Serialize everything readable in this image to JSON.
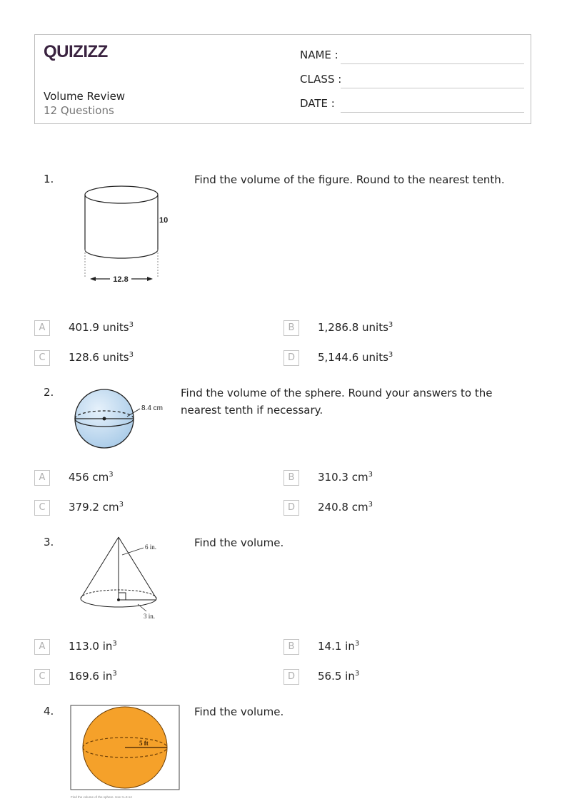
{
  "header": {
    "logo": "QUIZIZZ",
    "title": "Volume Review",
    "subtitle": "12 Questions",
    "fields": [
      {
        "label": "NAME :"
      },
      {
        "label": "CLASS :"
      },
      {
        "label": "DATE  :"
      }
    ]
  },
  "questions": [
    {
      "number": "1.",
      "text": "Find the volume of the figure. Round to the nearest tenth.",
      "figure": {
        "type": "cylinder",
        "height_label": "10",
        "diameter_label": "12.8"
      },
      "options": [
        {
          "letter": "A",
          "value": "401.9 units",
          "exp": "3"
        },
        {
          "letter": "B",
          "value": "1,286.8 units",
          "exp": "3"
        },
        {
          "letter": "C",
          "value": "128.6 units",
          "exp": "3"
        },
        {
          "letter": "D",
          "value": "5,144.6 units",
          "exp": "3"
        }
      ]
    },
    {
      "number": "2.",
      "text": "Find the volume of the sphere. Round your answers to the nearest tenth if necessary.",
      "figure": {
        "type": "sphere",
        "radius_label": "8.4 cm"
      },
      "options": [
        {
          "letter": "A",
          "value": "456 cm",
          "exp": "3"
        },
        {
          "letter": "B",
          "value": "310.3 cm",
          "exp": "3"
        },
        {
          "letter": "C",
          "value": "379.2 cm",
          "exp": "3"
        },
        {
          "letter": "D",
          "value": "240.8 cm",
          "exp": "3"
        }
      ]
    },
    {
      "number": "3.",
      "text": "Find the volume.",
      "figure": {
        "type": "cone",
        "height_label": "6 in.",
        "radius_label": "3 in."
      },
      "options": [
        {
          "letter": "A",
          "value": "113.0 in",
          "exp": "3"
        },
        {
          "letter": "B",
          "value": "14.1 in",
          "exp": "3"
        },
        {
          "letter": "C",
          "value": "169.6 in",
          "exp": "3"
        },
        {
          "letter": "D",
          "value": "56.5 in",
          "exp": "3"
        }
      ]
    },
    {
      "number": "4.",
      "text": "Find the volume.",
      "figure": {
        "type": "sphere",
        "radius_label": "5 ft",
        "caption": "Find the volume of the sphere. Use π=3.14",
        "fill": "#f5a12a"
      }
    }
  ]
}
